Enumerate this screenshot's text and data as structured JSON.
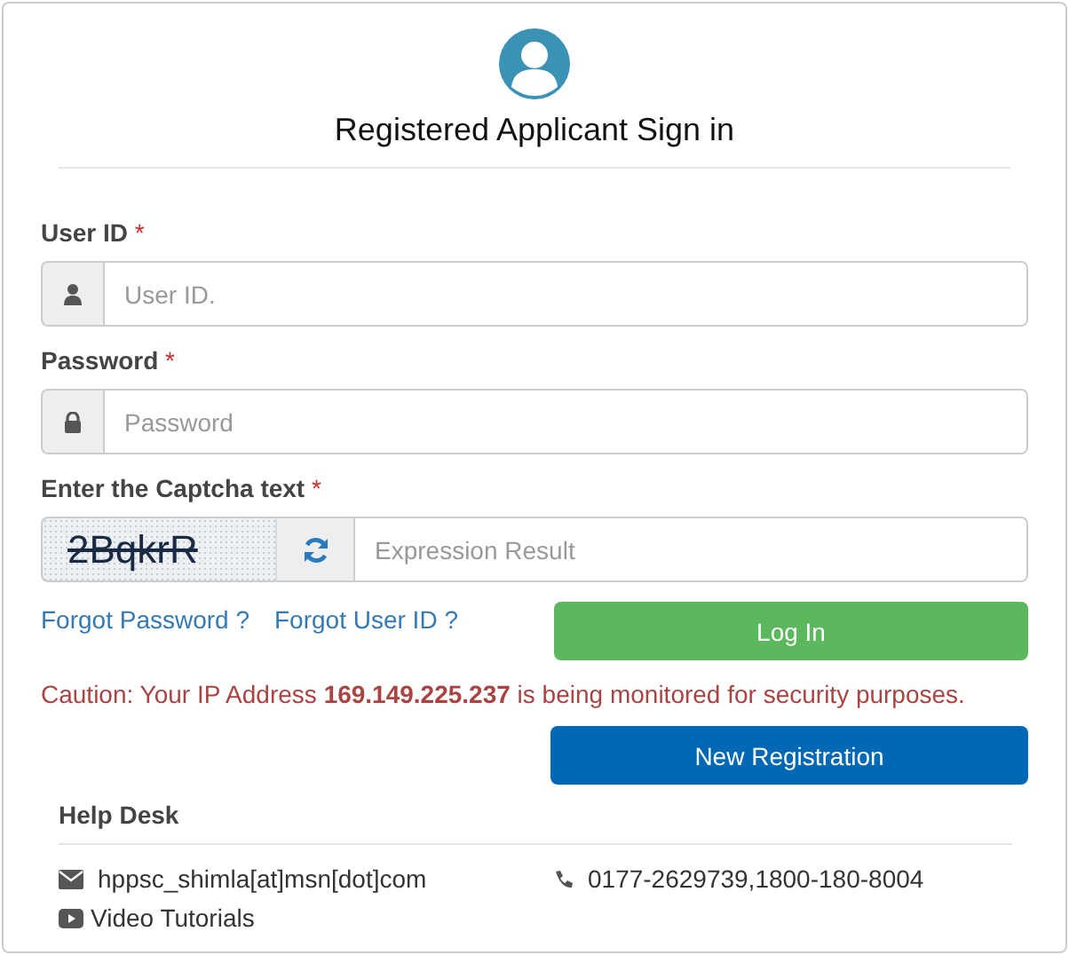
{
  "header": {
    "title": "Registered Applicant Sign in"
  },
  "fields": [
    {
      "kind": "user",
      "label": "User ID",
      "required_mark": "*",
      "placeholder": "User ID."
    },
    {
      "kind": "password",
      "label": "Password",
      "required_mark": "*",
      "placeholder": "Password"
    },
    {
      "kind": "captcha",
      "label": "Enter the Captcha text",
      "required_mark": "*",
      "captcha": "2BqkrR",
      "placeholder": "Expression Result"
    }
  ],
  "links": [
    "Forgot Password ?",
    "Forgot User ID ?"
  ],
  "login_button": "Log In",
  "caution": "Caution: Your IP Address **169.149.225.237** is being monitored for security purposes.",
  "register_button": "New Registration",
  "help_desk": {
    "title": "Help Desk",
    "email": "hppsc_shimla[at]msn[dot]com",
    "phone": "0177-2629739,1800-180-8004",
    "video": "Video Tutorials"
  }
}
